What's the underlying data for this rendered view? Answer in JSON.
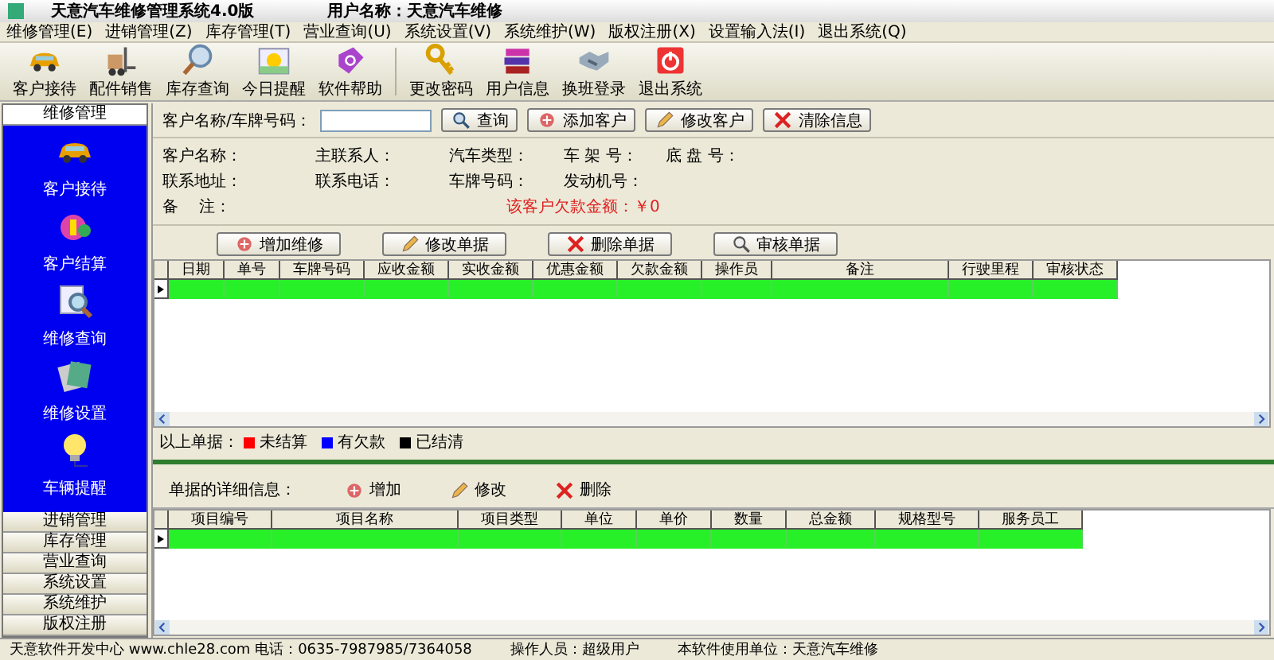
{
  "window": {
    "title": "天意汽车维修管理系统4.0版",
    "user": "用户名称：天意汽车维修"
  },
  "menu": [
    "维修管理(E)",
    "进销管理(Z)",
    "库存管理(T)",
    "营业查询(U)",
    "系统设置(V)",
    "系统维护(W)",
    "版权注册(X)",
    "设置输入法(I)",
    "退出系统(Q)"
  ],
  "toolbar": {
    "groups": [
      [
        "客户接待",
        "配件销售",
        "库存查询",
        "今日提醒",
        "软件帮助"
      ],
      [
        "更改密码",
        "用户信息",
        "换班登录",
        "退出系统"
      ]
    ]
  },
  "sidebar": {
    "sections": [
      {
        "label": "维修管理",
        "expanded": true,
        "items": [
          "客户接待",
          "客户结算",
          "维修查询",
          "维修设置",
          "车辆提醒"
        ]
      },
      {
        "label": "进销管理",
        "expanded": false
      },
      {
        "label": "库存管理",
        "expanded": false
      },
      {
        "label": "营业查询",
        "expanded": false
      },
      {
        "label": "系统设置",
        "expanded": false
      },
      {
        "label": "系统维护",
        "expanded": false
      },
      {
        "label": "版权注册",
        "expanded": false
      }
    ]
  },
  "search": {
    "label": "客户名称/车牌号码：",
    "buttons": [
      "查询",
      "添加客户",
      "修改客户",
      "清除信息"
    ]
  },
  "customer_info": {
    "rows": [
      [
        "客户名称：",
        "主联系人：",
        "汽车类型：",
        "车 架 号：",
        "底 盘 号："
      ],
      [
        "联系地址：",
        "联系电话：",
        "车牌号码：",
        "发动机号："
      ],
      [
        "备　 注："
      ]
    ],
    "debt": "该客户欠款金额：￥0"
  },
  "order_buttons": [
    "增加维修",
    "修改单据",
    "删除单据",
    "审核单据"
  ],
  "orders_table": {
    "columns": [
      "日期",
      "单号",
      "车牌号码",
      "应收金额",
      "实收金额",
      "优惠金额",
      "欠款金额",
      "操作员",
      "备注",
      "行驶里程",
      "审核状态"
    ]
  },
  "legend": {
    "label": "以上单据：",
    "items": [
      {
        "label": "未结算",
        "color": "#ff0000"
      },
      {
        "label": "有欠款",
        "color": "#0000ff"
      },
      {
        "label": "已结清",
        "color": "#000000"
      }
    ]
  },
  "details": {
    "label": "单据的详细信息：",
    "buttons": [
      "增加",
      "修改",
      "删除"
    ],
    "columns": [
      "项目编号",
      "项目名称",
      "项目类型",
      "单位",
      "单价",
      "数量",
      "总金额",
      "规格型号",
      "服务员工"
    ]
  },
  "status_bar": [
    "天意软件开发中心 www.chle28.com 电话：0635-7987985/7364058",
    "操作人员：超级用户",
    "本软件使用单位：天意汽车维修"
  ]
}
